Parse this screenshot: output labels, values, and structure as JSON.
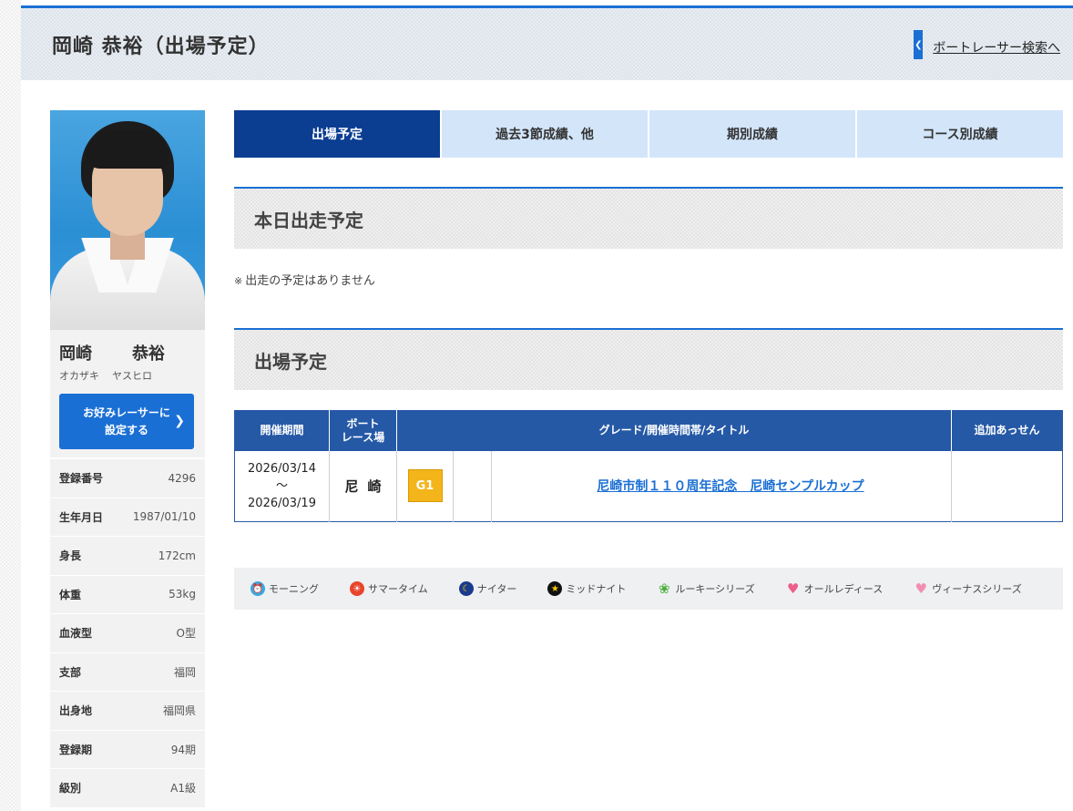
{
  "header": {
    "title": "岡崎 恭裕（出場予定）",
    "search_link": "ボートレーサー検索へ"
  },
  "racer": {
    "name_family": "岡崎",
    "name_given": "恭裕",
    "kana_family": "オカザキ",
    "kana_given": "ヤスヒロ",
    "fav_button_line1": "お好みレーサーに",
    "fav_button_line2": "設定する"
  },
  "profile": [
    {
      "label": "登録番号",
      "value": "4296"
    },
    {
      "label": "生年月日",
      "value": "1987/01/10"
    },
    {
      "label": "身長",
      "value": "172cm"
    },
    {
      "label": "体重",
      "value": "53kg"
    },
    {
      "label": "血液型",
      "value": "O型"
    },
    {
      "label": "支部",
      "value": "福岡"
    },
    {
      "label": "出身地",
      "value": "福岡県"
    },
    {
      "label": "登録期",
      "value": "94期"
    },
    {
      "label": "級別",
      "value": "A1級"
    }
  ],
  "tabs": [
    {
      "label": "出場予定",
      "active": true
    },
    {
      "label": "過去3節成績、他",
      "active": false
    },
    {
      "label": "期別成績",
      "active": false
    },
    {
      "label": "コース別成績",
      "active": false
    }
  ],
  "today": {
    "heading": "本日出走予定",
    "note_mark": "※",
    "note": "出走の予定はありません"
  },
  "schedule": {
    "heading": "出場予定",
    "columns": {
      "period": "開催期間",
      "venue_line1": "ボート",
      "venue_line2": "レース場",
      "grade_title": "グレード/開催時間帯/タイトル",
      "extra": "追加あっせん"
    },
    "rows": [
      {
        "start": "2026/03/14",
        "tilde": "〜",
        "end": "2026/03/19",
        "venue": "尼崎",
        "grade": "G1",
        "time_slot": "",
        "title": "尼崎市制１１０周年記念　尼崎センプルカップ",
        "extra": ""
      }
    ]
  },
  "legend": [
    {
      "label": "モーニング",
      "icon": "morning-icon",
      "color": "#3aa8e0"
    },
    {
      "label": "サマータイム",
      "icon": "summer-icon",
      "color": "#e8452c"
    },
    {
      "label": "ナイター",
      "icon": "nighter-icon",
      "color": "#1b3a8c"
    },
    {
      "label": "ミッドナイト",
      "icon": "midnight-icon",
      "color": "#111111"
    },
    {
      "label": "ルーキーシリーズ",
      "icon": "rookie-icon",
      "color": "#4caf3c"
    },
    {
      "label": "オールレディース",
      "icon": "ladies-icon",
      "color": "#ec5f8a"
    },
    {
      "label": "ヴィーナスシリーズ",
      "icon": "venus-icon",
      "color": "#f08fb0"
    }
  ]
}
